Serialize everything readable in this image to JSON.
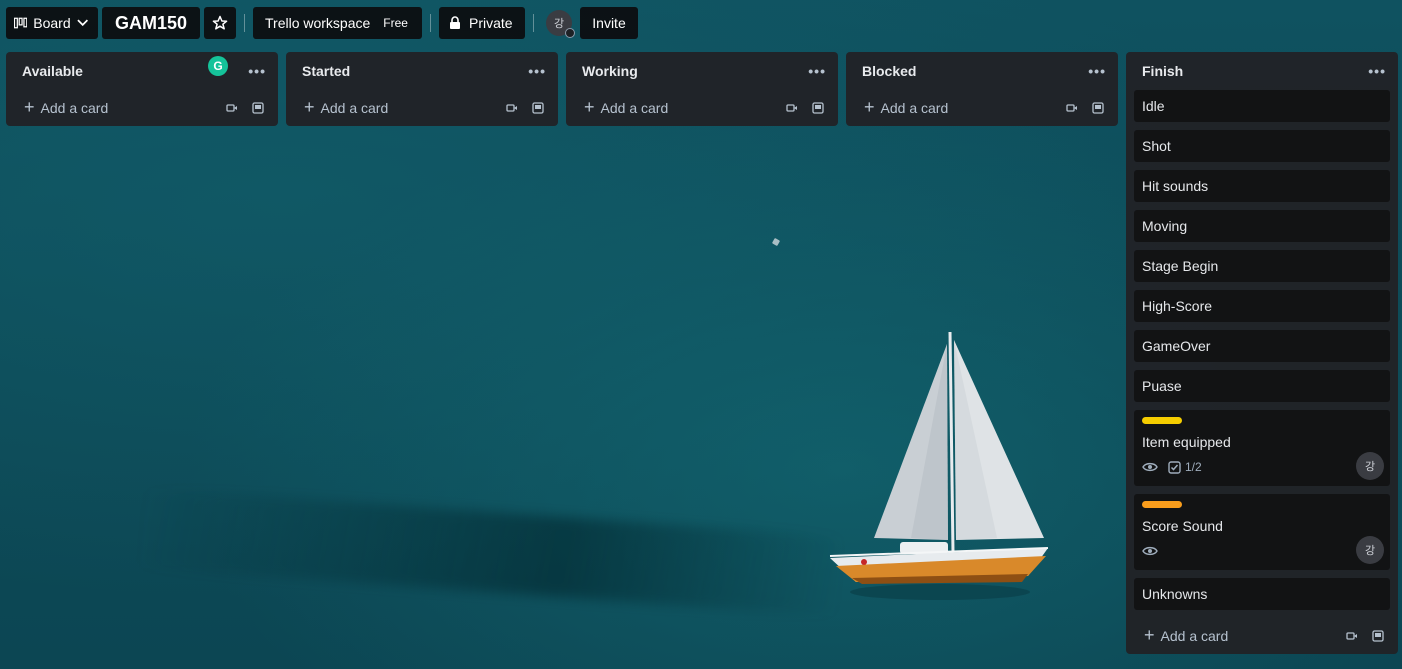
{
  "topbar": {
    "board_label": "Board",
    "board_title": "GAM150",
    "workspace_label": "Trello workspace",
    "workspace_plan": "Free",
    "visibility_label": "Private",
    "avatar_initial": "강",
    "invite_label": "Invite"
  },
  "add_card_label": "Add a card",
  "grammarly_initial": "G",
  "lists": [
    {
      "title": "Available"
    },
    {
      "title": "Started"
    },
    {
      "title": "Working"
    },
    {
      "title": "Blocked"
    },
    {
      "title": "Finish",
      "cards": [
        {
          "title": "Idle"
        },
        {
          "title": "Shot"
        },
        {
          "title": "Hit sounds"
        },
        {
          "title": "Moving"
        },
        {
          "title": "Stage Begin"
        },
        {
          "title": "High-Score"
        },
        {
          "title": "GameOver"
        },
        {
          "title": "Puase"
        },
        {
          "title": "Item equipped",
          "label_color": "#f5cd00",
          "checklist": "1/2",
          "member_initial": "강"
        },
        {
          "title": "Score Sound",
          "label_color": "#f99d1c",
          "member_initial": "강"
        },
        {
          "title": "Unknowns"
        }
      ]
    }
  ],
  "icons": {
    "board": "board-icon",
    "chevron": "chevron-down-icon",
    "star": "star-icon",
    "lock": "lock-icon",
    "menu": "more-dots-icon",
    "plus": "plus-icon",
    "template": "template-icon",
    "video": "video-icon",
    "watch": "eye-icon",
    "checklist": "checklist-icon"
  }
}
